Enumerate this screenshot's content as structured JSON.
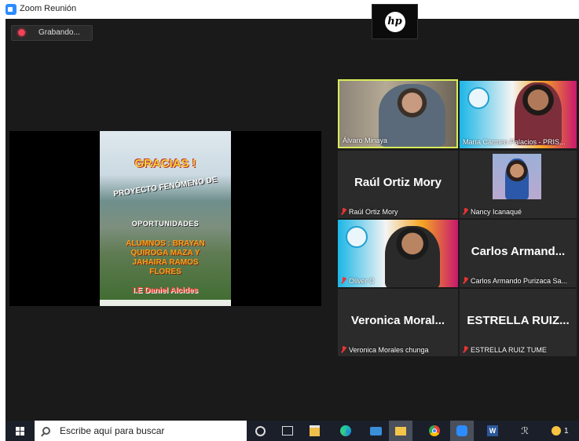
{
  "window": {
    "title": "Zoom Reunión"
  },
  "recording": {
    "label": "Grabando..."
  },
  "share": {
    "slide": {
      "title": "GRACIAS !",
      "project": "PROYECTO FENÓMENO DE",
      "subtitle": "OPORTUNIDADES",
      "students_line1": "ALUMNOS : BRAYAN",
      "students_line2": "QUIROGA MAZA Y",
      "students_line3": "JAHAIRA RAMOS",
      "students_line4": "FLORES",
      "school": "I.E Daniel Alcides"
    }
  },
  "participants": [
    {
      "display_name": "Álvaro Minaya",
      "video": true,
      "muted": false,
      "active_speaker": true
    },
    {
      "display_name": "María  Carmen Palacios - PRIS...",
      "video": true,
      "muted": false
    },
    {
      "big_name": "Raúl Ortiz Mory",
      "display_name": "Raúl Ortiz Mory",
      "video": false,
      "muted": true
    },
    {
      "display_name": "Nancy Icanaqué",
      "video": true,
      "muted": true
    },
    {
      "display_name": "Oliver C",
      "video": true,
      "muted": true
    },
    {
      "big_name": "Carlos  Armand...",
      "display_name": "Carlos Armando Purizaca Sa...",
      "video": false,
      "muted": true
    },
    {
      "big_name": "Veronica  Moral...",
      "display_name": "Veronica Morales chunga",
      "video": false,
      "muted": true
    },
    {
      "big_name": "ESTRELLA  RUIZ...",
      "display_name": "ESTRELLA RUIZ TUME",
      "video": false,
      "muted": true
    }
  ],
  "taskbar": {
    "search_placeholder": "Escribe aquí para buscar",
    "word_letter": "W",
    "people_glyph": "ℛ",
    "weather_value": "1"
  },
  "colors": {
    "zoom_blue": "#2d8cff",
    "active_speaker": "#d8ec5a",
    "muted_red": "#e33"
  }
}
